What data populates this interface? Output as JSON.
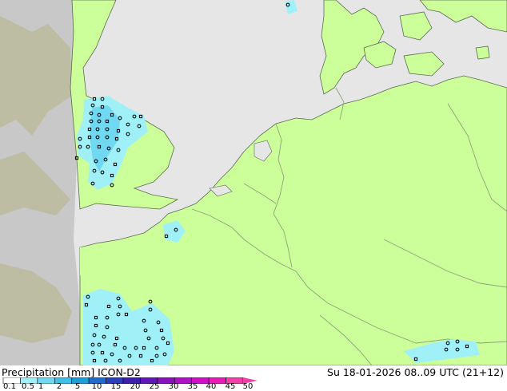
{
  "map": {
    "colors": {
      "sea": "#e6e6e6",
      "land_forecast": "#ccff99",
      "land_outside_domain": "#c8c8c8",
      "land_outside_domain_2": "#bdbda3",
      "borders": "#8ca37a",
      "coast": "#5a6a50",
      "precip_light": "#a0f0f8",
      "precip_medium": "#70d8f0",
      "marker": "#000000"
    }
  },
  "legend": {
    "title_left": "Precipitation [mm]  ICON-D2",
    "title_right": "Su 18-01-2026 08..09 UTC (21+12)",
    "ticks": [
      "0.1",
      "0.5",
      "1",
      "2",
      "5",
      "10",
      "15",
      "20",
      "25",
      "30",
      "35",
      "40",
      "45",
      "50"
    ],
    "colors": [
      "#ffffff",
      "#a0f0f8",
      "#70d8f0",
      "#40c0e8",
      "#1c9ed8",
      "#1f6bd0",
      "#2a3fc0",
      "#3c20b0",
      "#6018b8",
      "#8a10c0",
      "#b010c8",
      "#d010c8",
      "#e81ab8",
      "#f040a8"
    ]
  }
}
